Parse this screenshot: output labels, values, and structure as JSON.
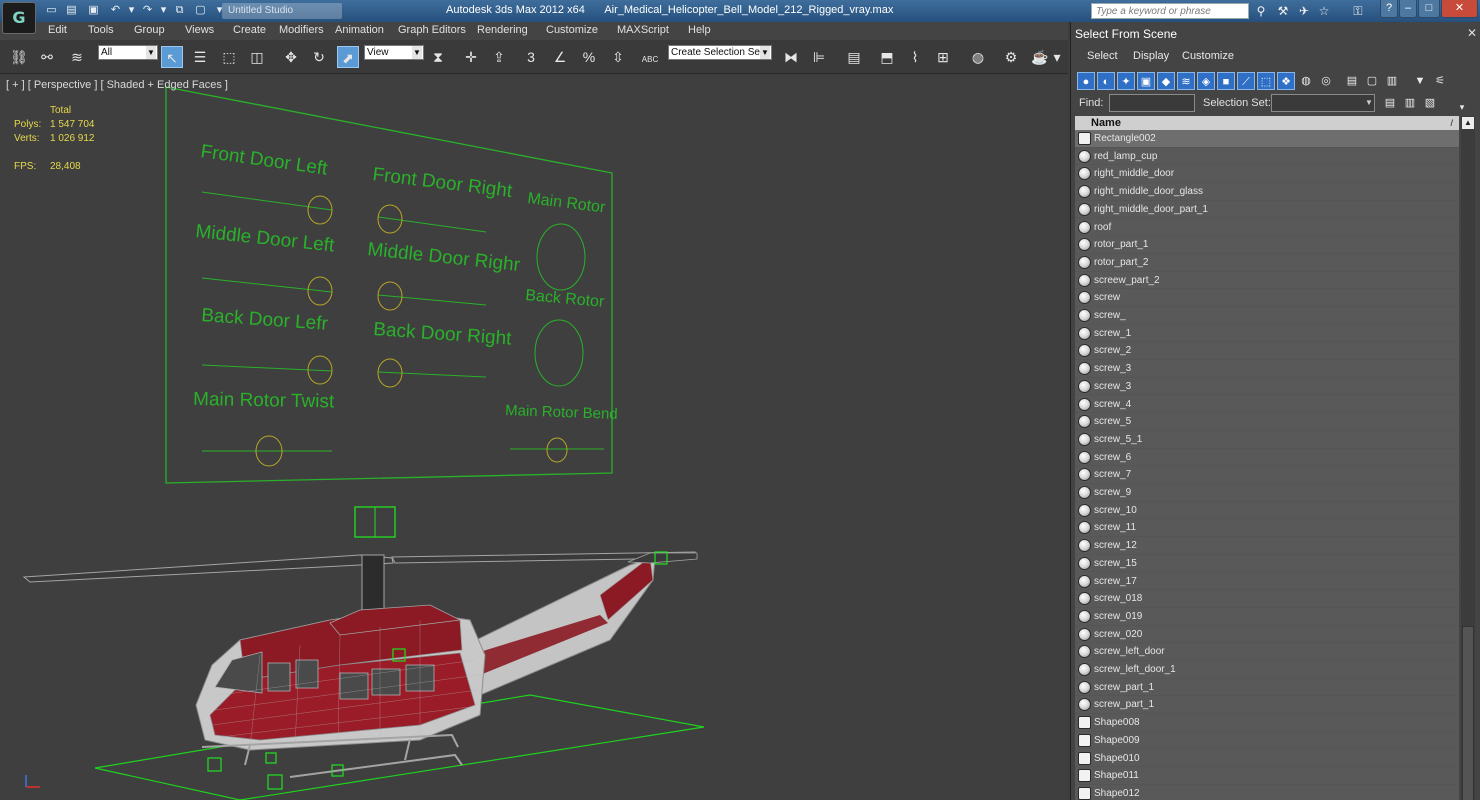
{
  "titlebar": {
    "logo": "G",
    "app_title": "Autodesk 3ds Max  2012 x64",
    "file_name": "Air_Medical_Helicopter_Bell_Model_212_Rigged_vray.max",
    "doc_tab": "Untitled Studio",
    "search_placeholder": "Type a keyword or phrase",
    "window_buttons": [
      "?",
      "–",
      "□",
      "✕"
    ]
  },
  "menubar": {
    "items": [
      "Edit",
      "Tools",
      "Group",
      "Views",
      "Create",
      "Modifiers",
      "Animation",
      "Graph Editors",
      "Rendering",
      "Customize",
      "MAXScript",
      "Help"
    ]
  },
  "toolbar": {
    "selection_filter": "All",
    "reference_coord": "View",
    "named_selection_placeholder": "Create Selection Se",
    "snap_labels": [
      "3",
      "%",
      "ABC"
    ]
  },
  "viewport": {
    "label": "[ + ] [ Perspective ] [ Shaded + Edged Faces ]",
    "stats": {
      "total_label": "Total",
      "polys_label": "Polys:",
      "polys_value": "1 547 704",
      "verts_label": "Verts:",
      "verts_value": "1 026 912",
      "fps_label": "FPS:",
      "fps_value": "28,408"
    },
    "control_panel_labels": {
      "front_door_left": "Front Door Left",
      "front_door_right": "Front Door Right",
      "main_rotor": "Main Rotor",
      "middle_door_left": "Middle Door Left",
      "middle_door_right": "Middle Door Righr",
      "back_rotor": "Back Rotor",
      "back_door_left": "Back Door Lefr",
      "back_door_right": "Back Door Right",
      "main_rotor_twist": "Main Rotor Twist",
      "main_rotor_bend": "Main Rotor Bend"
    },
    "colors": {
      "background": "#3f3f3f",
      "rig_green": "#29b12a",
      "helper_green": "#1fe21f",
      "body_red": "#8b1a24",
      "wire_grey": "#a4a4a4"
    }
  },
  "panel": {
    "title": "Select From Scene",
    "close": "✕",
    "menu": [
      "Select",
      "Display",
      "Customize"
    ],
    "find_label": "Find:",
    "selection_set_label": "Selection Set:",
    "list_header": "Name",
    "sort_indicator": "/",
    "items": [
      {
        "name": "Rectangle002",
        "kind": "shape",
        "selected": true
      },
      {
        "name": "red_lamp_cup",
        "kind": "geometry"
      },
      {
        "name": "right_middle_door",
        "kind": "geometry"
      },
      {
        "name": "right_middle_door_glass",
        "kind": "geometry"
      },
      {
        "name": "right_middle_door_part_1",
        "kind": "geometry"
      },
      {
        "name": "roof",
        "kind": "geometry"
      },
      {
        "name": "rotor_part_1",
        "kind": "geometry"
      },
      {
        "name": "rotor_part_2",
        "kind": "geometry"
      },
      {
        "name": "screew_part_2",
        "kind": "geometry"
      },
      {
        "name": "screw",
        "kind": "geometry"
      },
      {
        "name": "screw_",
        "kind": "geometry"
      },
      {
        "name": "screw_1",
        "kind": "geometry"
      },
      {
        "name": "screw_2",
        "kind": "geometry"
      },
      {
        "name": "screw_3",
        "kind": "geometry"
      },
      {
        "name": "screw_3",
        "kind": "geometry"
      },
      {
        "name": "screw_4",
        "kind": "geometry"
      },
      {
        "name": "screw_5",
        "kind": "geometry"
      },
      {
        "name": "screw_5_1",
        "kind": "geometry"
      },
      {
        "name": "screw_6",
        "kind": "geometry"
      },
      {
        "name": "screw_7",
        "kind": "geometry"
      },
      {
        "name": "screw_9",
        "kind": "geometry"
      },
      {
        "name": "screw_10",
        "kind": "geometry"
      },
      {
        "name": "screw_11",
        "kind": "geometry"
      },
      {
        "name": "screw_12",
        "kind": "geometry"
      },
      {
        "name": "screw_15",
        "kind": "geometry"
      },
      {
        "name": "screw_17",
        "kind": "geometry"
      },
      {
        "name": "screw_018",
        "kind": "geometry"
      },
      {
        "name": "screw_019",
        "kind": "geometry"
      },
      {
        "name": "screw_020",
        "kind": "geometry"
      },
      {
        "name": "screw_left_door",
        "kind": "geometry"
      },
      {
        "name": "screw_left_door_1",
        "kind": "geometry"
      },
      {
        "name": "screw_part_1",
        "kind": "geometry"
      },
      {
        "name": "screw_part_1",
        "kind": "geometry"
      },
      {
        "name": "Shape008",
        "kind": "shape"
      },
      {
        "name": "Shape009",
        "kind": "shape"
      },
      {
        "name": "Shape010",
        "kind": "shape"
      },
      {
        "name": "Shape011",
        "kind": "shape"
      },
      {
        "name": "Shape012",
        "kind": "shape"
      }
    ]
  }
}
